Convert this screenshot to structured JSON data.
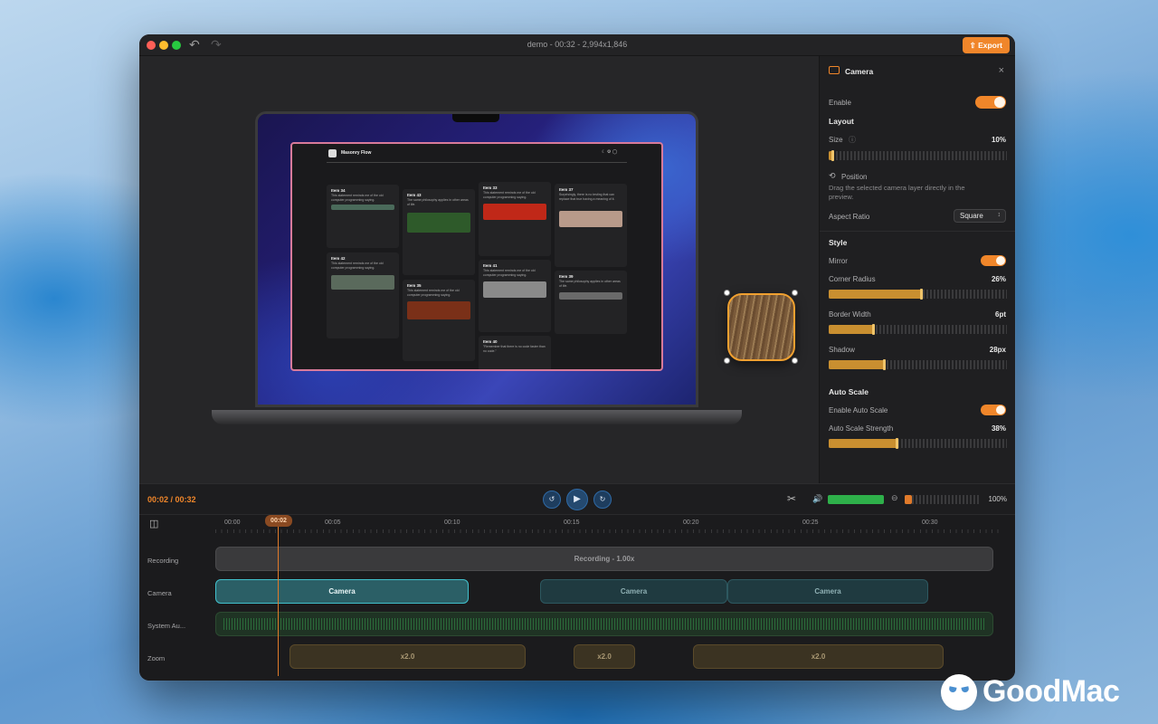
{
  "window": {
    "title": "demo - 00:32 - 2,994x1,846",
    "export_label": "Export"
  },
  "laptop_app": {
    "title": "Masonry Flow",
    "cards": [
      {
        "title": "Item 34",
        "text": "This statement reminds me of the old computer programming saying."
      },
      {
        "title": "Item 42",
        "text": "This statement reminds me of the old computer programming saying."
      },
      {
        "title": "Item 43",
        "text": "The same philosophy applies in other areas of life."
      },
      {
        "title": "Item 35",
        "text": "This statement reminds me of the old computer programming saying."
      },
      {
        "title": "Item 33",
        "text": "This statement reminds me of the old computer programming saying."
      },
      {
        "title": "Item 41",
        "text": "This statement reminds me of the old computer programming saying."
      },
      {
        "title": "Item 40",
        "text": "\"Remember that there is no code faster than no code.\""
      },
      {
        "title": "Item 37",
        "text": "Surprisingly, there is no testing that can replace that true having a meaning of it."
      },
      {
        "title": "Item 39",
        "text": "The same philosophy applies in other areas of life."
      }
    ]
  },
  "panel": {
    "title": "Camera",
    "enable_label": "Enable",
    "layout_heading": "Layout",
    "size_label": "Size",
    "size_value": "10%",
    "size_fraction": 0.02,
    "position_label": "Position",
    "position_help": "Drag the selected camera layer directly in the preview.",
    "aspect_label": "Aspect Ratio",
    "aspect_value": "Square",
    "style_heading": "Style",
    "mirror_label": "Mirror",
    "corner_label": "Corner Radius",
    "corner_value": "26%",
    "corner_fraction": 0.52,
    "border_label": "Border Width",
    "border_value": "6pt",
    "border_fraction": 0.25,
    "shadow_label": "Shadow",
    "shadow_value": "28px",
    "shadow_fraction": 0.31,
    "autoscale_heading": "Auto Scale",
    "enable_autoscale_label": "Enable Auto Scale",
    "autoscale_strength_label": "Auto Scale Strength",
    "autoscale_strength_value": "38%",
    "autoscale_strength_fraction": 0.38
  },
  "transport": {
    "time": "00:02 / 00:32",
    "zoom_value": "100%",
    "volume_fraction": 1.0
  },
  "timeline": {
    "playhead": "00:02",
    "ruler": [
      "00:00",
      "00:05",
      "00:10",
      "00:15",
      "00:20",
      "00:25",
      "00:30"
    ],
    "tracks": {
      "recording": "Recording",
      "camera": "Camera",
      "system_audio": "System Au...",
      "zoom": "Zoom"
    },
    "recording_clip": "Recording - 1.00x",
    "camera_clips": [
      "Camera",
      "Camera",
      "Camera"
    ],
    "zoom_clips": [
      "x2.0",
      "x2.0",
      "x2.0"
    ]
  },
  "brand": "GoodMac",
  "colors": {
    "accent": "#f0862a",
    "camera_clip_selected": "#41c0cc",
    "volume": "#2eb04a"
  }
}
